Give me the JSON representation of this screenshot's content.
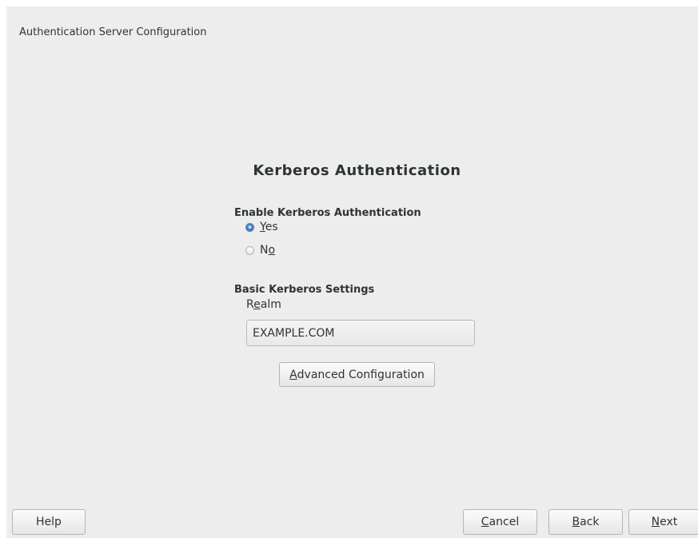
{
  "window": {
    "title": "Authentication Server Configuration"
  },
  "main": {
    "heading": "Kerberos Authentication",
    "enable_group": {
      "label": "Enable Kerberos Authentication",
      "options": [
        {
          "label_mnemonic": "Y",
          "label_rest": "es",
          "selected": true
        },
        {
          "label_prefix": "N",
          "label_mnemonic": "o",
          "selected": false
        }
      ]
    },
    "basic_settings": {
      "label": "Basic Kerberos Settings",
      "realm": {
        "label_prefix": "R",
        "label_mnemonic": "e",
        "label_rest": "alm",
        "value": "EXAMPLE.COM"
      }
    },
    "advanced_button": {
      "label_mnemonic": "A",
      "label_rest": "dvanced Configuration"
    }
  },
  "footer": {
    "help": "Help",
    "cancel": {
      "label_mnemonic": "C",
      "label_rest": "ancel"
    },
    "back": {
      "label_mnemonic": "B",
      "label_rest": "ack"
    },
    "next": {
      "label_mnemonic": "N",
      "label_rest": "ext"
    }
  },
  "colors": {
    "background": "#ededed",
    "text": "#2e3436",
    "radio_selected": "#4d8ad6"
  }
}
